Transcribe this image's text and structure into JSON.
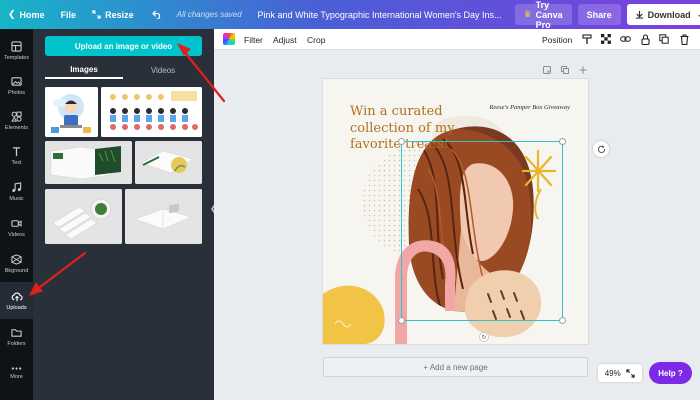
{
  "topbar": {
    "home": "Home",
    "file": "File",
    "resize": "Resize",
    "saved": "All changes saved",
    "title": "Pink and White Typographic International Women's Day Ins...",
    "try_pro": "Try Canva Pro",
    "share": "Share",
    "download": "Download",
    "more": "..."
  },
  "rail": {
    "items": [
      {
        "label": "Templates",
        "icon": "templates-icon"
      },
      {
        "label": "Photos",
        "icon": "photos-icon"
      },
      {
        "label": "Elements",
        "icon": "elements-icon"
      },
      {
        "label": "Text",
        "icon": "text-icon"
      },
      {
        "label": "Music",
        "icon": "music-icon"
      },
      {
        "label": "Videos",
        "icon": "videos-icon"
      },
      {
        "label": "Bkground",
        "icon": "background-icon"
      },
      {
        "label": "Uploads",
        "icon": "upload-cloud-icon"
      },
      {
        "label": "Folders",
        "icon": "folder-icon"
      },
      {
        "label": "More",
        "icon": "more-dots-icon"
      }
    ],
    "active": "Uploads"
  },
  "panel": {
    "upload_button": "Upload an image or video",
    "tabs": [
      "Images",
      "Videos"
    ],
    "active_tab": "Images"
  },
  "toolbar": {
    "filter": "Filter",
    "adjust": "Adjust",
    "crop": "Crop",
    "position": "Position"
  },
  "design": {
    "headline": "Win a curated collection of my favorite treats!",
    "tagline": "Reese's Pamper Box Giveaway"
  },
  "canvas": {
    "add_page": "+ Add a new page",
    "zoom": "49%",
    "help": "Help ?"
  },
  "colors": {
    "accent": "#00c4cc",
    "help": "#7d2ae8",
    "headline": "#b0701f",
    "selection": "#2ec2cc"
  }
}
